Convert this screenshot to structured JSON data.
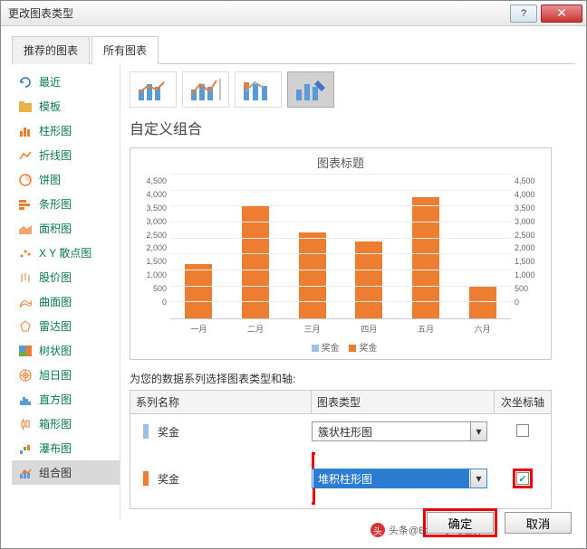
{
  "window": {
    "title": "更改图表类型"
  },
  "tabs": [
    {
      "label": "推荐的图表",
      "active": false
    },
    {
      "label": "所有图表",
      "active": true
    }
  ],
  "sidebar": {
    "items": [
      {
        "label": "最近",
        "icon": "recent"
      },
      {
        "label": "模板",
        "icon": "template"
      },
      {
        "label": "柱形图",
        "icon": "column"
      },
      {
        "label": "折线图",
        "icon": "line"
      },
      {
        "label": "饼图",
        "icon": "pie"
      },
      {
        "label": "条形图",
        "icon": "bar"
      },
      {
        "label": "面积图",
        "icon": "area"
      },
      {
        "label": "X Y 散点图",
        "icon": "scatter"
      },
      {
        "label": "股价图",
        "icon": "stock"
      },
      {
        "label": "曲面图",
        "icon": "surface"
      },
      {
        "label": "雷达图",
        "icon": "radar"
      },
      {
        "label": "树状图",
        "icon": "treemap"
      },
      {
        "label": "旭日图",
        "icon": "sunburst"
      },
      {
        "label": "直方图",
        "icon": "histogram"
      },
      {
        "label": "箱形图",
        "icon": "box"
      },
      {
        "label": "瀑布图",
        "icon": "waterfall"
      },
      {
        "label": "组合图",
        "icon": "combo",
        "selected": true
      }
    ]
  },
  "main": {
    "section_title": "自定义组合",
    "series_instruction": "为您的数据系列选择图表类型和轴:",
    "table": {
      "headers": {
        "name": "系列名称",
        "type": "图表类型",
        "axis": "次坐标轴"
      },
      "rows": [
        {
          "color": "#9bc2e6",
          "name": "奖金",
          "type": "簇状柱形图",
          "secondary": false,
          "highlight": false
        },
        {
          "color": "#ed7d31",
          "name": "奖金",
          "type": "堆积柱形图",
          "secondary": true,
          "highlight": true
        }
      ]
    }
  },
  "chart_data": {
    "type": "bar",
    "title": "图表标题",
    "categories": [
      "一月",
      "二月",
      "三月",
      "四月",
      "五月",
      "六月"
    ],
    "series": [
      {
        "name": "奖金",
        "color": "#9bc2e6",
        "values": [
          1700,
          3500,
          2700,
          2400,
          3800,
          1000
        ]
      },
      {
        "name": "奖金",
        "color": "#ed7d31",
        "values": [
          1700,
          3500,
          2700,
          2400,
          3800,
          1000
        ]
      }
    ],
    "ylim": [
      0,
      4500
    ],
    "yticks": [
      0,
      500,
      1000,
      1500,
      2000,
      2500,
      3000,
      3500,
      4000,
      4500
    ],
    "legend": [
      "奖金",
      "奖金"
    ]
  },
  "buttons": {
    "ok": "确定",
    "cancel": "取消"
  },
  "watermark": "头条@Excel学习世界"
}
